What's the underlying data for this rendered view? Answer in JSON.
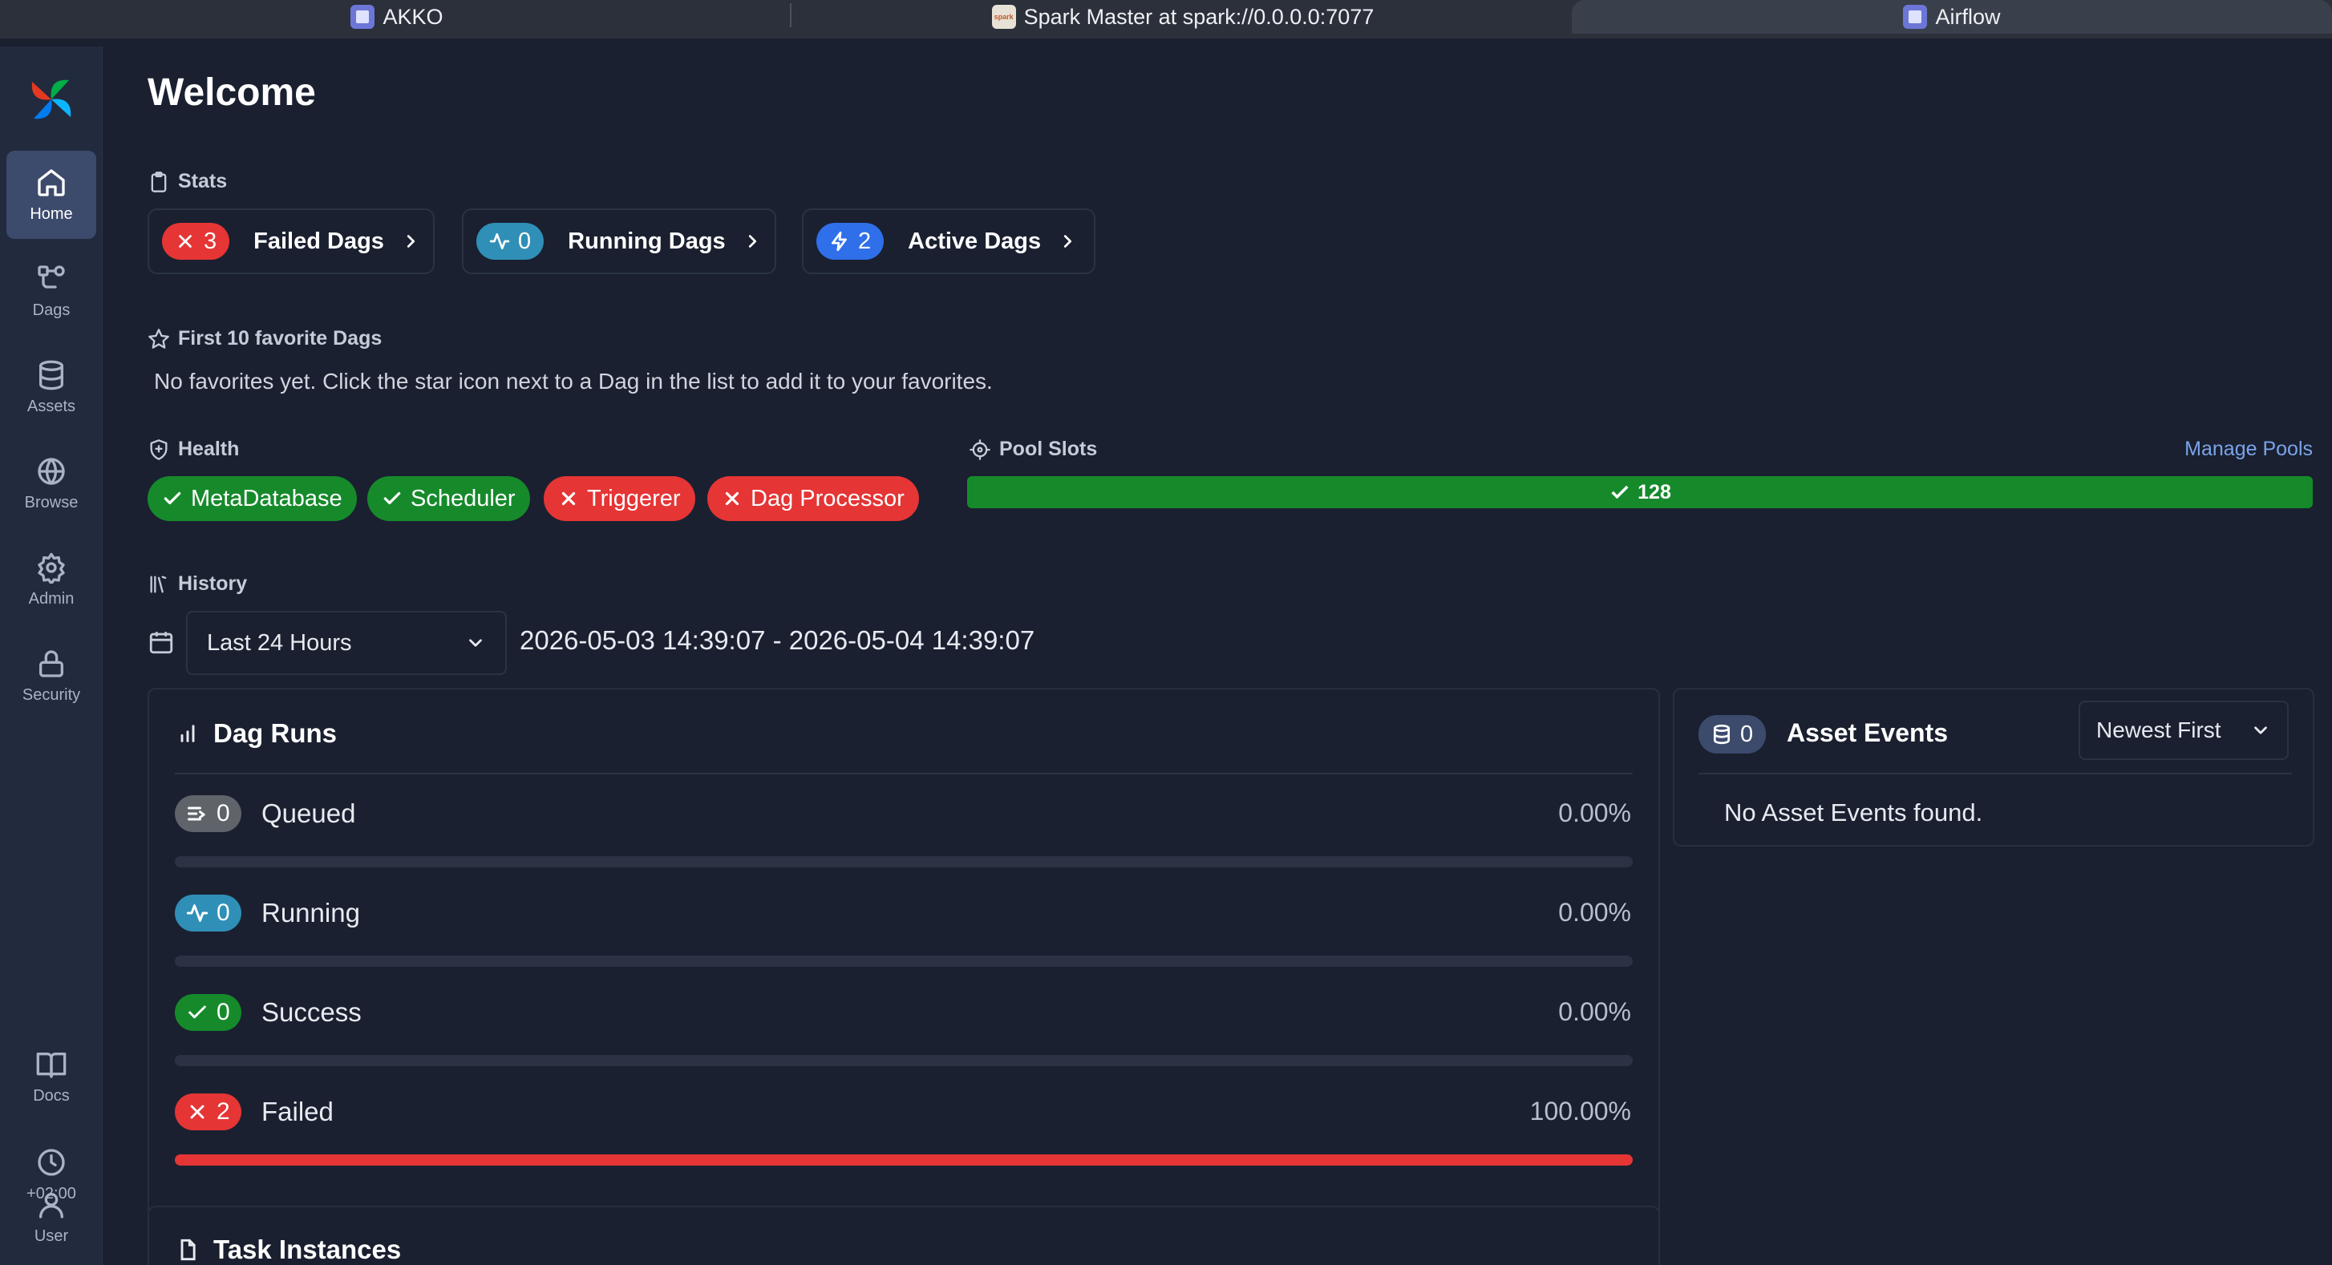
{
  "browser": {
    "tabs": [
      {
        "label": "AKKO",
        "icon": "akko-favicon"
      },
      {
        "label": "Spark Master at spark://0.0.0.0:7077",
        "icon": "spark-favicon"
      },
      {
        "label": "Airflow",
        "icon": "airflow-favicon",
        "active": true
      }
    ]
  },
  "sidebar": {
    "items": [
      {
        "label": "Home",
        "icon": "home-icon",
        "active": true
      },
      {
        "label": "Dags",
        "icon": "dags-icon"
      },
      {
        "label": "Assets",
        "icon": "database-icon"
      },
      {
        "label": "Browse",
        "icon": "globe-icon"
      },
      {
        "label": "Admin",
        "icon": "gear-icon"
      },
      {
        "label": "Security",
        "icon": "lock-icon"
      }
    ],
    "bottom": [
      {
        "label": "Docs",
        "icon": "book-icon"
      },
      {
        "label": "+02:00",
        "icon": "clock-icon"
      },
      {
        "label": "User",
        "icon": "user-icon"
      }
    ]
  },
  "page": {
    "title": "Welcome"
  },
  "stats": {
    "label": "Stats",
    "cards": [
      {
        "count": "3",
        "label": "Failed Dags",
        "color": "#e53535"
      },
      {
        "count": "0",
        "label": "Running Dags",
        "color": "#2f8fb7"
      },
      {
        "count": "2",
        "label": "Active Dags",
        "color": "#2f6fea"
      }
    ]
  },
  "favorites": {
    "label": "First 10 favorite Dags",
    "empty_text": "No favorites yet. Click the star icon next to a Dag in the list to add it to your favorites."
  },
  "health": {
    "label": "Health",
    "items": [
      {
        "label": "MetaDatabase",
        "status": "ok"
      },
      {
        "label": "Scheduler",
        "status": "ok"
      },
      {
        "label": "Triggerer",
        "status": "error"
      },
      {
        "label": "Dag Processor",
        "status": "error"
      }
    ]
  },
  "pool_slots": {
    "label": "Pool Slots",
    "manage_link": "Manage Pools",
    "value": "128"
  },
  "history": {
    "label": "History",
    "range_select": "Last 24 Hours",
    "range_text": "2026-05-03 14:39:07 - 2026-05-04 14:39:07"
  },
  "dag_runs": {
    "title": "Dag Runs",
    "rows": [
      {
        "count": "0",
        "label": "Queued",
        "pct": "0.00%",
        "fraction": 0.0,
        "color": "#5f636a",
        "icon": "queue-icon"
      },
      {
        "count": "0",
        "label": "Running",
        "pct": "0.00%",
        "fraction": 0.0,
        "color": "#2f8fb7",
        "icon": "activity-icon"
      },
      {
        "count": "0",
        "label": "Success",
        "pct": "0.00%",
        "fraction": 0.0,
        "color": "#168a2b",
        "icon": "check-icon"
      },
      {
        "count": "2",
        "label": "Failed",
        "pct": "100.00%",
        "fraction": 1.0,
        "color": "#e53535",
        "icon": "x-icon"
      }
    ]
  },
  "task_instances": {
    "title": "Task Instances"
  },
  "asset_events": {
    "count": "0",
    "title": "Asset Events",
    "sort": "Newest First",
    "empty_text": "No Asset Events found."
  }
}
